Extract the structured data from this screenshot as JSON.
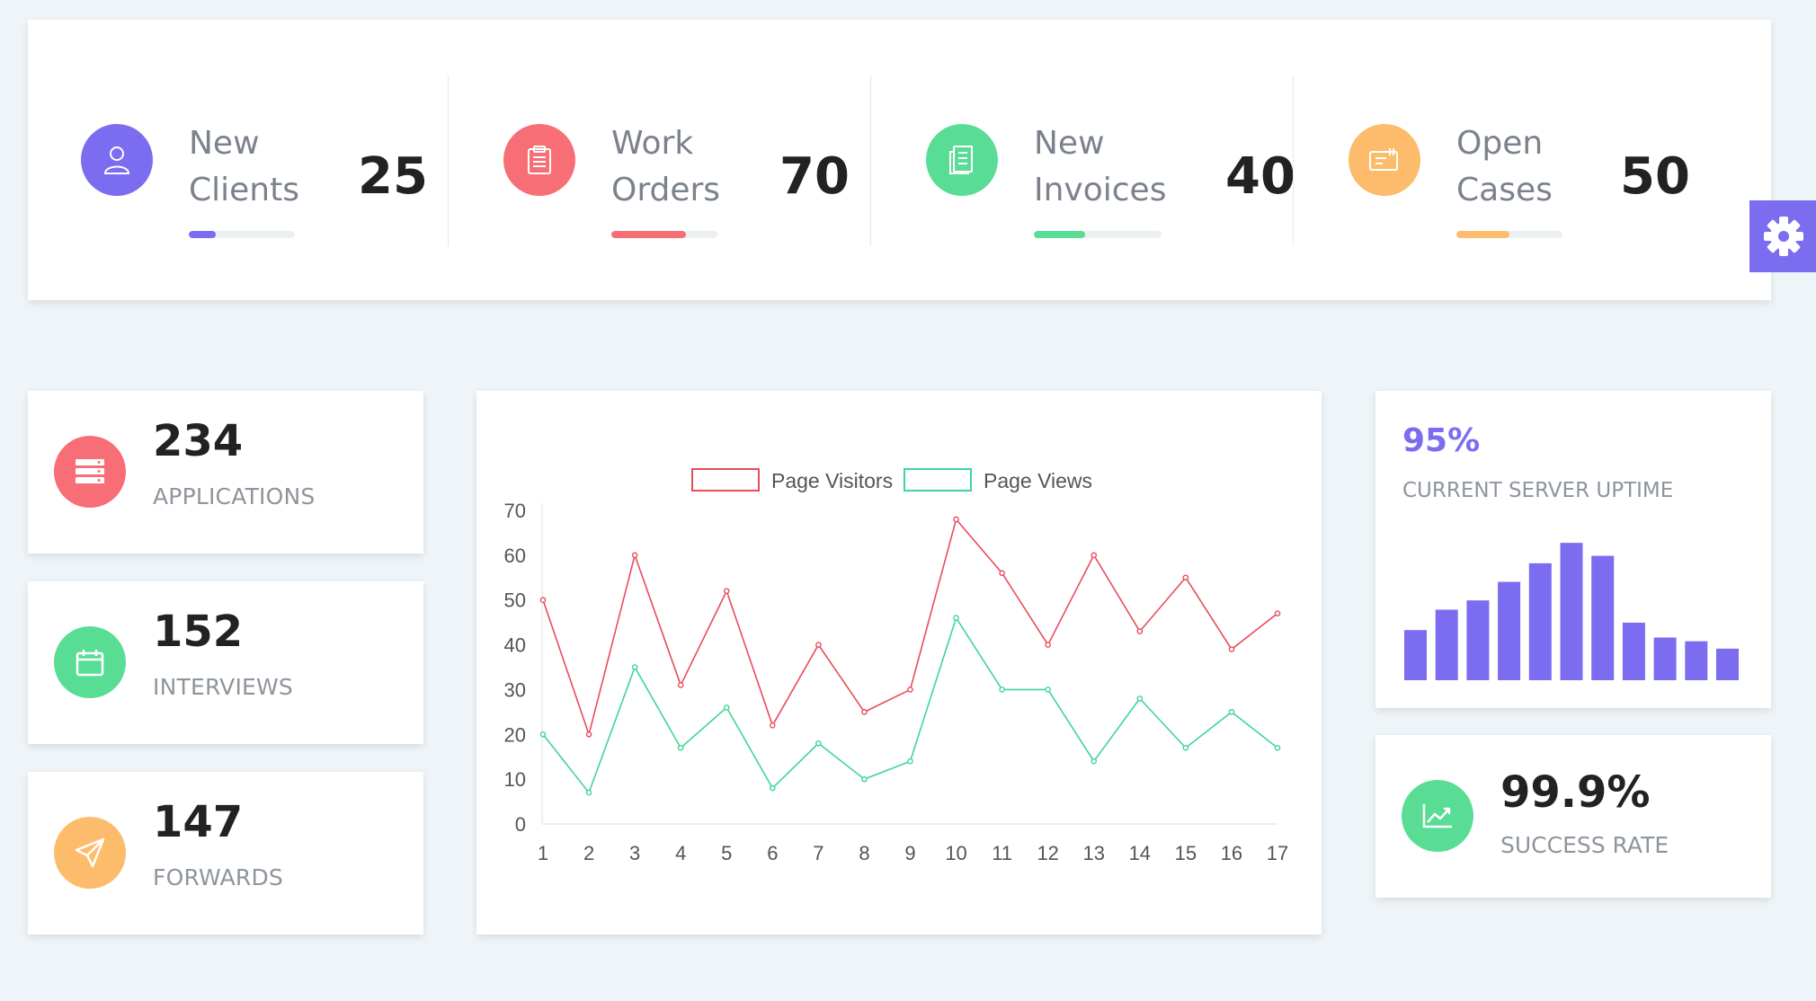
{
  "top_stats": [
    {
      "label_line1": "New",
      "label_line2": "Clients",
      "value": "25",
      "color": "#7b6cf0",
      "icon": "user-icon",
      "progress": 0.25
    },
    {
      "label_line1": "Work",
      "label_line2": "Orders",
      "value": "70",
      "color": "#f76e77",
      "icon": "clipboard-icon",
      "progress": 0.7
    },
    {
      "label_line1": "New",
      "label_line2": "Invoices",
      "value": "40",
      "color": "#59dd95",
      "icon": "invoice-icon",
      "progress": 0.4
    },
    {
      "label_line1": "Open",
      "label_line2": "Cases",
      "value": "50",
      "color": "#fdbc6b",
      "icon": "ticket-icon",
      "progress": 0.5
    }
  ],
  "settings": {
    "icon": "gear-icon",
    "color": "#7b6cf0"
  },
  "small_cards": [
    {
      "value": "234",
      "label": "APPLICATIONS",
      "color": "#f76e77",
      "icon": "server-icon"
    },
    {
      "value": "152",
      "label": "INTERVIEWS",
      "color": "#59dd95",
      "icon": "calendar-icon"
    },
    {
      "value": "147",
      "label": "FORWARDS",
      "color": "#fdbc6b",
      "icon": "paper-plane-icon"
    }
  ],
  "chart_data": [
    {
      "type": "line",
      "x": [
        1,
        2,
        3,
        4,
        5,
        6,
        7,
        8,
        9,
        10,
        11,
        12,
        13,
        14,
        15,
        16,
        17
      ],
      "series": [
        {
          "name": "Page Visitors",
          "color": "#e94b5b",
          "values": [
            50,
            20,
            60,
            31,
            52,
            22,
            40,
            25,
            30,
            68,
            56,
            40,
            60,
            43,
            55,
            39,
            47
          ]
        },
        {
          "name": "Page Views",
          "color": "#3fd597",
          "values": [
            20,
            7,
            35,
            17,
            26,
            8,
            18,
            10,
            14,
            46,
            30,
            30,
            14,
            28,
            17,
            25,
            17
          ]
        }
      ],
      "ylim": [
        0,
        70
      ],
      "yticks": [
        0,
        10,
        20,
        30,
        40,
        50,
        60,
        70
      ],
      "legend": "top-center",
      "grid": false
    },
    {
      "type": "bar",
      "values": [
        27,
        38,
        43,
        53,
        63,
        74,
        67,
        31,
        23,
        21,
        17
      ],
      "ylim": [
        0,
        76
      ],
      "color": "#7b6cf0"
    }
  ],
  "uptime": {
    "value": "95%",
    "label": "CURRENT SERVER UPTIME"
  },
  "success": {
    "value": "99.9%",
    "label": "SUCCESS RATE",
    "color": "#59dd95",
    "icon": "trending-up-icon"
  }
}
